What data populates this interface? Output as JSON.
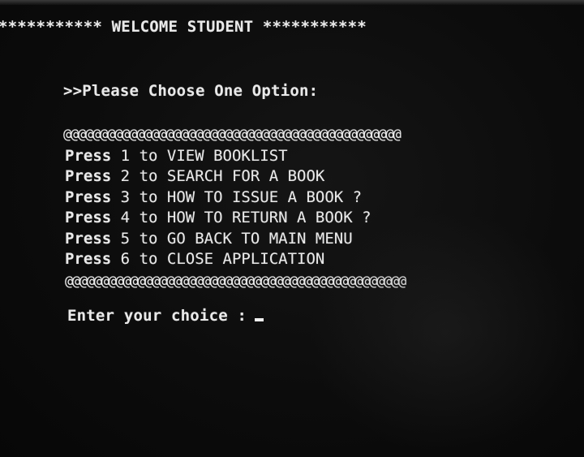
{
  "header": {
    "title": "*********** WELCOME STUDENT ***********"
  },
  "prompt": ">>Please Choose One Option:",
  "border_top": "@@@@@@@@@@@@@@@@@@@@@@@@@@@@@@@@@@@@@@@@@@@@@@",
  "menu": {
    "items": [
      {
        "key": "1",
        "label": "VIEW BOOKLIST"
      },
      {
        "key": "2",
        "label": "SEARCH FOR A BOOK"
      },
      {
        "key": "3",
        "label": "HOW TO ISSUE A BOOK ?"
      },
      {
        "key": "4",
        "label": "HOW TO RETURN A BOOK ?"
      },
      {
        "key": "5",
        "label": "GO BACK TO MAIN MENU"
      },
      {
        "key": "6",
        "label": "CLOSE APPLICATION"
      }
    ],
    "press_word": "Press",
    "to_word": "to"
  },
  "border_bottom": "@@@@@@@@@@@@@@@@@@@@@@@@@@@@@@@@@@@@@@@@@@@@@@@",
  "input": {
    "label": "Enter your choice :",
    "value": ""
  },
  "colors": {
    "background": "#0b0b0b",
    "text": "#e9e9e9"
  }
}
